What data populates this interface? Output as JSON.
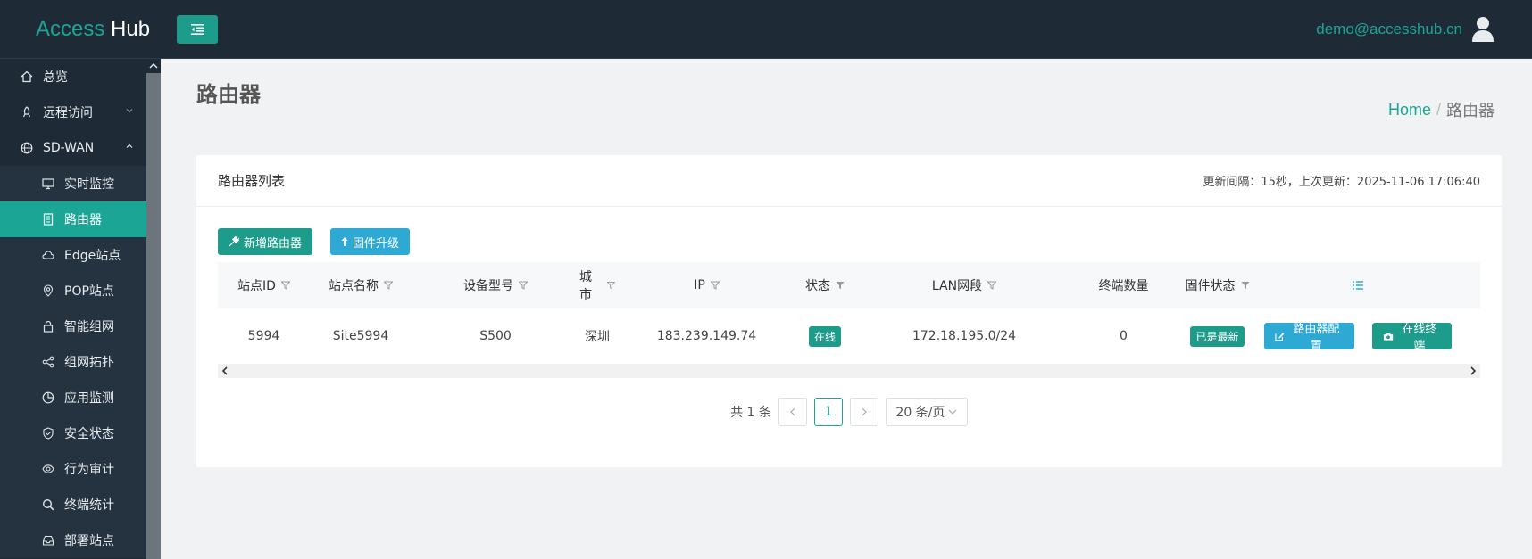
{
  "brand": {
    "part1": "Access",
    "part2": "Hub"
  },
  "user": {
    "email": "demo@accesshub.cn"
  },
  "sidebar": {
    "items": [
      {
        "label": "总览",
        "icon": "home-icon"
      },
      {
        "label": "远程访问",
        "icon": "rocket-icon"
      },
      {
        "label": "SD-WAN",
        "icon": "globe-icon"
      },
      {
        "label": "实时监控",
        "icon": "monitor-icon"
      },
      {
        "label": "路由器",
        "icon": "router-icon"
      },
      {
        "label": "Edge站点",
        "icon": "cloud-icon"
      },
      {
        "label": "POP站点",
        "icon": "location-pin-icon"
      },
      {
        "label": "智能组网",
        "icon": "lock-icon"
      },
      {
        "label": "组网拓扑",
        "icon": "share-icon"
      },
      {
        "label": "应用监测",
        "icon": "pie-chart-icon"
      },
      {
        "label": "安全状态",
        "icon": "shield-icon"
      },
      {
        "label": "行为审计",
        "icon": "eye-icon"
      },
      {
        "label": "终端统计",
        "icon": "search-icon"
      },
      {
        "label": "部署站点",
        "icon": "inbox-icon"
      }
    ]
  },
  "page": {
    "title": "路由器"
  },
  "breadcrumb": {
    "home": "Home",
    "sep": "/",
    "current": "路由器"
  },
  "card": {
    "title": "路由器列表",
    "meta": "更新间隔：15秒，上次更新：2025-11-06 17:06:40",
    "add_button": "新增路由器",
    "upgrade_button": "固件升级"
  },
  "table": {
    "headers": [
      "站点ID",
      "站点名称",
      "设备型号",
      "城市",
      "IP",
      "状态",
      "LAN网段",
      "终端数量",
      "固件状态"
    ],
    "rows": [
      {
        "site_id": "5994",
        "site_name": "Site5994",
        "model": "S500",
        "city": "深圳",
        "ip": "183.239.149.74",
        "status": "在线",
        "lan": "172.18.195.0/24",
        "terminals": "0",
        "firmware": "已是最新",
        "config_button": "路由器配置",
        "terminal_button": "在线终端"
      }
    ]
  },
  "pager": {
    "total": "共 1 条",
    "current": "1",
    "size": "20 条/页"
  },
  "colors": {
    "accent": "#1aa595",
    "sidebar_bg": "#1e2a36",
    "blue": "#2da9d4"
  }
}
